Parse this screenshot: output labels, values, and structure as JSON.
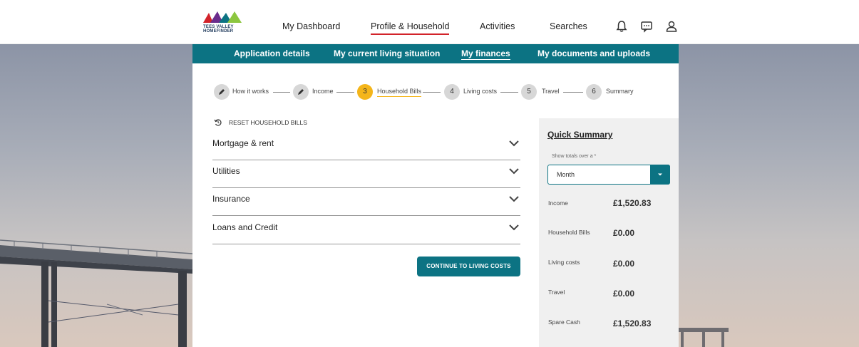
{
  "header": {
    "logo_line1": "TEES VALLEY",
    "logo_line2": "HOMEFINDER",
    "nav": [
      {
        "label": "My Dashboard"
      },
      {
        "label": "Profile & Household"
      },
      {
        "label": "Activities"
      },
      {
        "label": "Searches"
      }
    ],
    "icons": [
      "bell-icon",
      "chat-icon",
      "user-icon"
    ]
  },
  "subnav": [
    {
      "label": "Application details"
    },
    {
      "label": "My current living situation"
    },
    {
      "label": "My finances"
    },
    {
      "label": "My documents and uploads"
    }
  ],
  "stepper": [
    {
      "marker": "pencil-icon",
      "label": "How it works"
    },
    {
      "marker": "pencil-icon",
      "label": "Income"
    },
    {
      "marker": "3",
      "label": "Household Bills"
    },
    {
      "marker": "4",
      "label": "Living costs"
    },
    {
      "marker": "5",
      "label": "Travel"
    },
    {
      "marker": "6",
      "label": "Summary"
    }
  ],
  "reset_label": "RESET HOUSEHOLD BILLS",
  "accordions": [
    {
      "title": "Mortgage & rent"
    },
    {
      "title": "Utilities"
    },
    {
      "title": "Insurance"
    },
    {
      "title": "Loans and Credit"
    }
  ],
  "continue_label": "CONTINUE TO LIVING COSTS",
  "summary": {
    "title": "Quick Summary",
    "select_label": "Show totals over a *",
    "select_value": "Month",
    "rows": [
      {
        "label": "Income",
        "value": "£1,520.83"
      },
      {
        "label": "Household Bills",
        "value": "£0.00"
      },
      {
        "label": "Living costs",
        "value": "£0.00"
      },
      {
        "label": "Travel",
        "value": "£0.00"
      },
      {
        "label": "Spare Cash",
        "value": "£1,520.83"
      }
    ]
  },
  "colors": {
    "teal": "#0c7383",
    "current_step": "#f4b51a",
    "active_nav_underline": "#d2232a"
  }
}
